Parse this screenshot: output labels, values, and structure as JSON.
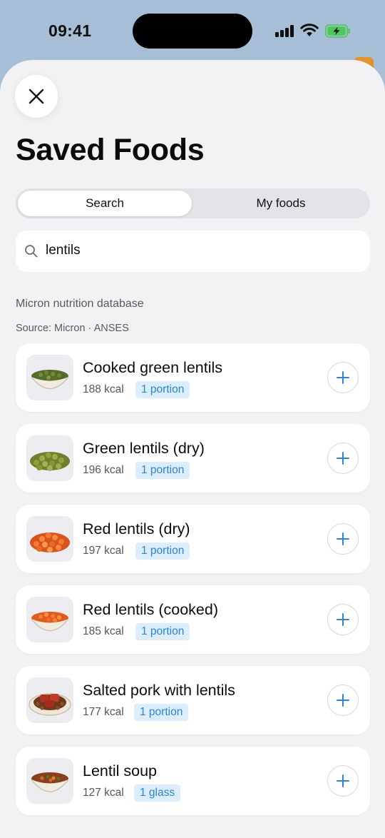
{
  "status": {
    "time": "09:41"
  },
  "header": {
    "title": "Saved Foods",
    "close_icon": "close-icon"
  },
  "segments": [
    {
      "label": "Search",
      "selected": true
    },
    {
      "label": "My foods",
      "selected": false
    }
  ],
  "search": {
    "value": "lentils",
    "icon": "search-icon"
  },
  "database": {
    "label": "Micron nutrition database",
    "source": "Source: Micron · ANSES"
  },
  "foods": [
    {
      "name": "Cooked green lentils",
      "kcal": "188 kcal",
      "portion": "1 portion",
      "icon": "green-lentils-bowl-icon"
    },
    {
      "name": "Green lentils (dry)",
      "kcal": "196 kcal",
      "portion": "1 portion",
      "icon": "green-lentils-pile-icon"
    },
    {
      "name": "Red lentils (dry)",
      "kcal": "197 kcal",
      "portion": "1 portion",
      "icon": "red-lentils-pile-icon"
    },
    {
      "name": "Red lentils (cooked)",
      "kcal": "185 kcal",
      "portion": "1 portion",
      "icon": "red-lentils-bowl-icon"
    },
    {
      "name": "Salted pork with lentils",
      "kcal": "177 kcal",
      "portion": "1 portion",
      "icon": "pork-lentils-plate-icon"
    },
    {
      "name": "Lentil soup",
      "kcal": "127 kcal",
      "portion": "1 glass",
      "icon": "lentil-soup-bowl-icon"
    }
  ],
  "colors": {
    "accent": "#2b84d9",
    "portion_bg": "#dceefe",
    "sheet_bg": "#f2f2f5",
    "backdrop": "#a7bfd6"
  }
}
